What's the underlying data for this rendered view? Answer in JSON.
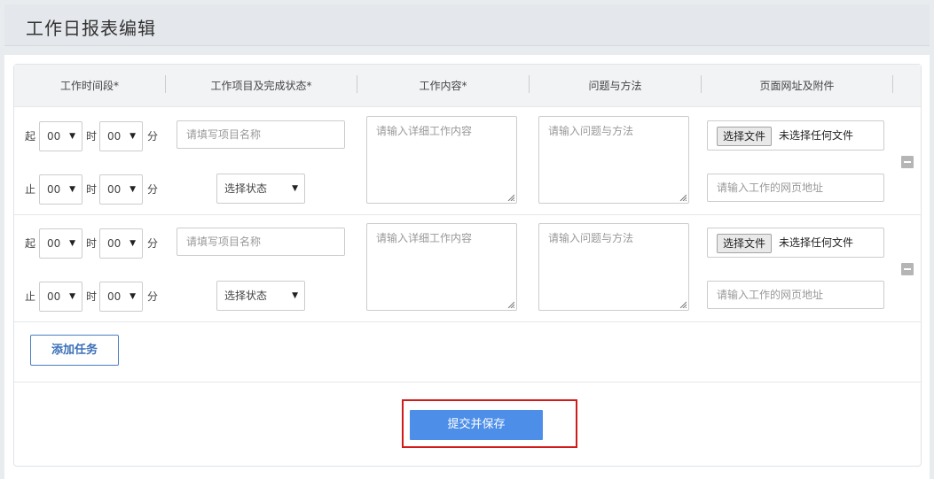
{
  "page": {
    "title": "工作日报表编辑"
  },
  "table": {
    "headers": [
      "工作时间段*",
      "工作项目及完成状态*",
      "工作内容*",
      "问题与方法",
      "页面网址及附件"
    ]
  },
  "labels": {
    "start": "起",
    "end": "止",
    "hour": "时",
    "minute": "分"
  },
  "rows": [
    {
      "start_hour": "00",
      "start_minute": "00",
      "end_hour": "00",
      "end_minute": "00",
      "project_placeholder": "请填写项目名称",
      "status": "选择状态",
      "content_placeholder": "请输入详细工作内容",
      "problem_placeholder": "请输入问题与方法",
      "file_button": "选择文件",
      "file_text": "未选择任何文件",
      "url_placeholder": "请输入工作的网页地址"
    },
    {
      "start_hour": "00",
      "start_minute": "00",
      "end_hour": "00",
      "end_minute": "00",
      "project_placeholder": "请填写项目名称",
      "status": "选择状态",
      "content_placeholder": "请输入详细工作内容",
      "problem_placeholder": "请输入问题与方法",
      "file_button": "选择文件",
      "file_text": "未选择任何文件",
      "url_placeholder": "请输入工作的网页地址"
    }
  ],
  "actions": {
    "add_task": "添加任务",
    "submit": "提交并保存"
  },
  "colors": {
    "primary": "#4d8fe8",
    "highlight_border": "#d11a1a",
    "add_border": "#4a7fc1"
  },
  "icons": {
    "dropdown": "caret-down-icon",
    "remove_row": "minus-icon",
    "textarea_resize": "resize-grip-icon"
  }
}
